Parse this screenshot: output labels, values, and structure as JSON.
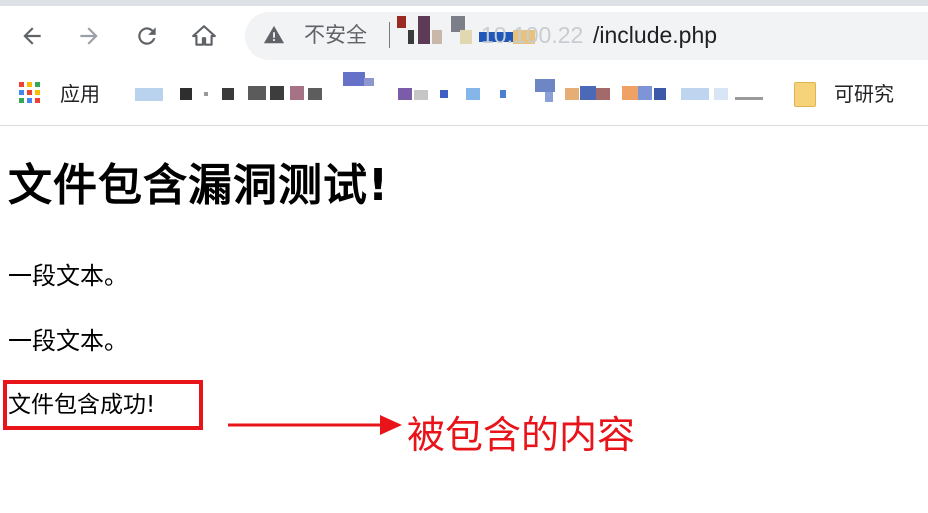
{
  "browser": {
    "security_label": "不安全",
    "url_host_faded": "10.100.22",
    "url_path": "/include.php"
  },
  "bookmarks": {
    "apps_label": "应用",
    "folder_label": "可研究"
  },
  "page": {
    "title": "文件包含漏洞测试!",
    "paragraphs": [
      "一段文本。",
      "一段文本。"
    ],
    "included_text": "文件包含成功!"
  },
  "annotation": {
    "label": "被包含的内容",
    "color": "#e8141a"
  },
  "icons": {
    "back": "back-arrow-icon",
    "forward": "forward-arrow-icon",
    "reload": "reload-icon",
    "home": "home-icon",
    "warning": "warning-triangle-icon",
    "apps": "apps-grid-icon",
    "folder": "folder-icon"
  }
}
